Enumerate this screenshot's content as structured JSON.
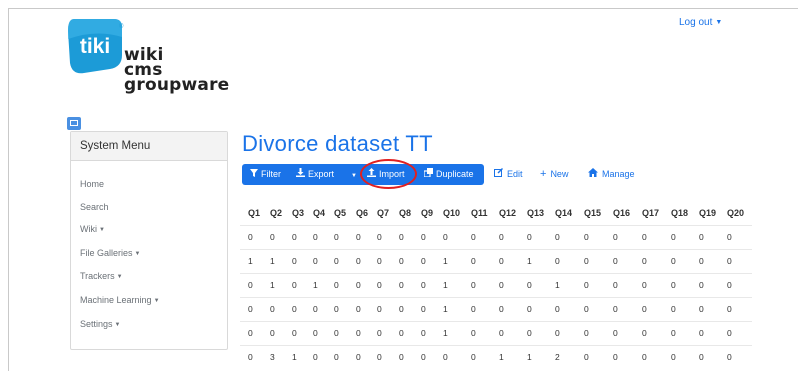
{
  "header": {
    "logo": {
      "mark_text": "tiki",
      "registered": "®",
      "wordmark": [
        "wiki",
        "cms",
        "groupware"
      ],
      "brand_color": "#1c9bd7"
    },
    "logout_label": "Log out"
  },
  "sidebar": {
    "title": "System Menu",
    "items": [
      {
        "label": "Home",
        "has_caret": false
      },
      {
        "label": "Search",
        "has_caret": false
      },
      {
        "label": "Wiki",
        "has_caret": true
      },
      {
        "label": "File Galleries",
        "has_caret": true
      },
      {
        "label": "Trackers",
        "has_caret": true
      },
      {
        "label": "Machine Learning",
        "has_caret": true
      },
      {
        "label": "Settings",
        "has_caret": true
      }
    ]
  },
  "main": {
    "title": "Divorce dataset TT",
    "toolbar": {
      "filter": {
        "label": "Filter",
        "icon": "filter-icon"
      },
      "export": {
        "label": "Export",
        "icon": "download-icon"
      },
      "import": {
        "label": "Import",
        "icon": "upload-icon"
      },
      "duplicate": {
        "label": "Duplicate",
        "icon": "copy-icon"
      },
      "edit": {
        "label": "Edit",
        "icon": "edit-icon"
      },
      "new": {
        "label": "New",
        "icon": "plus-icon"
      },
      "manage": {
        "label": "Manage",
        "icon": "home-icon"
      }
    },
    "table": {
      "columns": [
        "Q1",
        "Q2",
        "Q3",
        "Q4",
        "Q5",
        "Q6",
        "Q7",
        "Q8",
        "Q9",
        "Q10",
        "Q11",
        "Q12",
        "Q13",
        "Q14",
        "Q15",
        "Q16",
        "Q17",
        "Q18",
        "Q19",
        "Q20"
      ],
      "rows": [
        [
          "0",
          "0",
          "0",
          "0",
          "0",
          "0",
          "0",
          "0",
          "0",
          "0",
          "0",
          "0",
          "0",
          "0",
          "0",
          "0",
          "0",
          "0",
          "0",
          "0"
        ],
        [
          "1",
          "1",
          "0",
          "0",
          "0",
          "0",
          "0",
          "0",
          "0",
          "1",
          "0",
          "0",
          "1",
          "0",
          "0",
          "0",
          "0",
          "0",
          "0",
          "0"
        ],
        [
          "0",
          "1",
          "0",
          "1",
          "0",
          "0",
          "0",
          "0",
          "0",
          "1",
          "0",
          "0",
          "0",
          "1",
          "0",
          "0",
          "0",
          "0",
          "0",
          "0"
        ],
        [
          "0",
          "0",
          "0",
          "0",
          "0",
          "0",
          "0",
          "0",
          "0",
          "1",
          "0",
          "0",
          "0",
          "0",
          "0",
          "0",
          "0",
          "0",
          "0",
          "0"
        ],
        [
          "0",
          "0",
          "0",
          "0",
          "0",
          "0",
          "0",
          "0",
          "0",
          "1",
          "0",
          "0",
          "0",
          "0",
          "0",
          "0",
          "0",
          "0",
          "0",
          "0"
        ],
        [
          "0",
          "3",
          "1",
          "0",
          "0",
          "0",
          "0",
          "0",
          "0",
          "0",
          "0",
          "1",
          "1",
          "2",
          "0",
          "0",
          "0",
          "0",
          "0",
          "0"
        ]
      ]
    }
  },
  "colors": {
    "accent": "#1a73e8",
    "highlight_ring": "#e02020"
  }
}
